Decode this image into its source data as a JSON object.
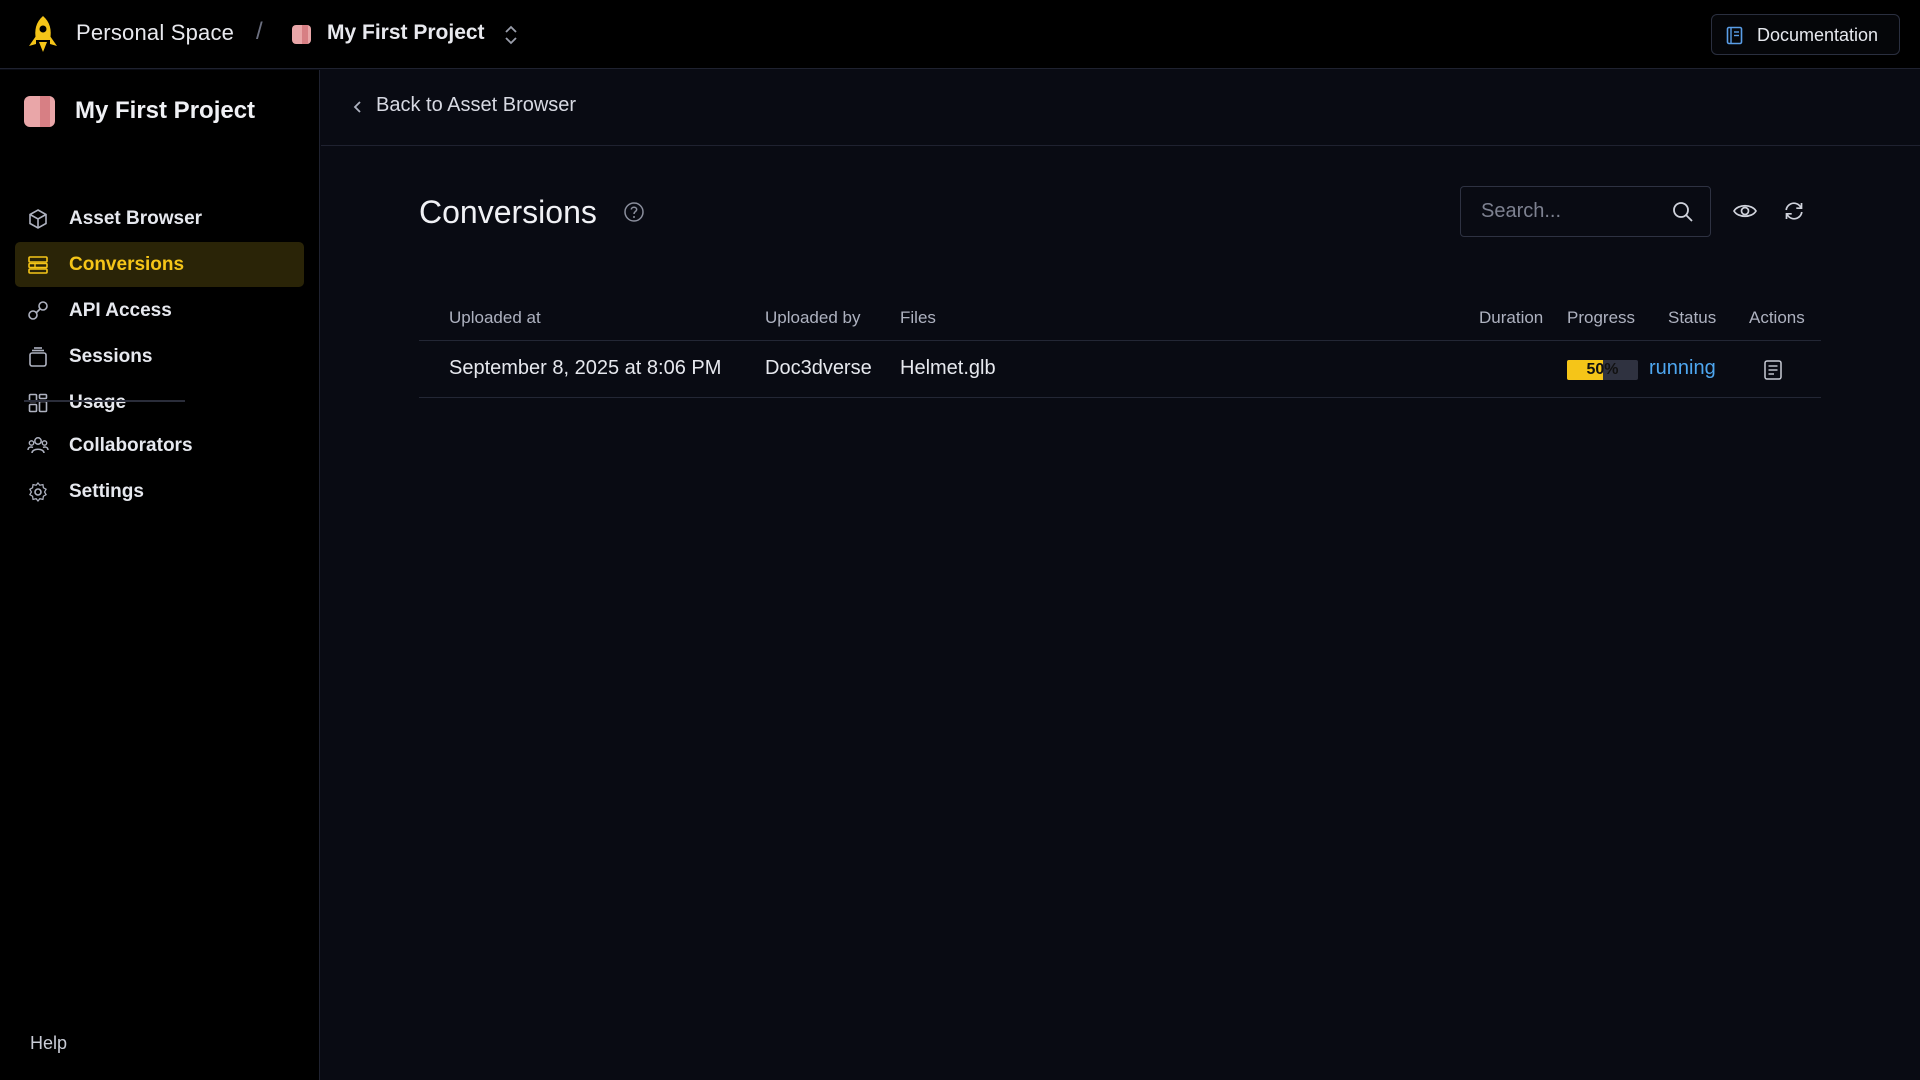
{
  "topbar": {
    "space_name": "Personal Space",
    "separator": "/",
    "project_name": "My First Project",
    "docs_label": "Documentation"
  },
  "sidebar": {
    "project_title": "My First Project",
    "items": [
      {
        "label": "Asset Browser",
        "icon": "cube-icon",
        "active": false
      },
      {
        "label": "Conversions",
        "icon": "conversions-icon",
        "active": true
      },
      {
        "label": "API Access",
        "icon": "key-icon",
        "active": false
      },
      {
        "label": "Sessions",
        "icon": "sessions-icon",
        "active": false
      },
      {
        "label": "Usage",
        "icon": "usage-icon",
        "active": false
      }
    ],
    "items2": [
      {
        "label": "Collaborators",
        "icon": "users-icon"
      },
      {
        "label": "Settings",
        "icon": "gear-icon"
      }
    ],
    "help": "Help"
  },
  "main": {
    "back_label": "Back to Asset Browser",
    "title": "Conversions",
    "search": {
      "placeholder": "Search...",
      "value": ""
    },
    "columns": [
      "Uploaded at",
      "Uploaded by",
      "Files",
      "Duration",
      "Progress",
      "Status",
      "Actions"
    ],
    "rows": [
      {
        "uploaded_at": "September 8, 2025 at 8:06 PM",
        "uploaded_by": "Doc3dverse",
        "files": "Helmet.glb",
        "duration": "",
        "progress_value": 50,
        "progress_label": "50%",
        "status": "running"
      }
    ]
  },
  "colors": {
    "accent": "#f5c518",
    "status_running": "#4ea7f0",
    "background": "#090b13",
    "topbar": "#000000"
  }
}
